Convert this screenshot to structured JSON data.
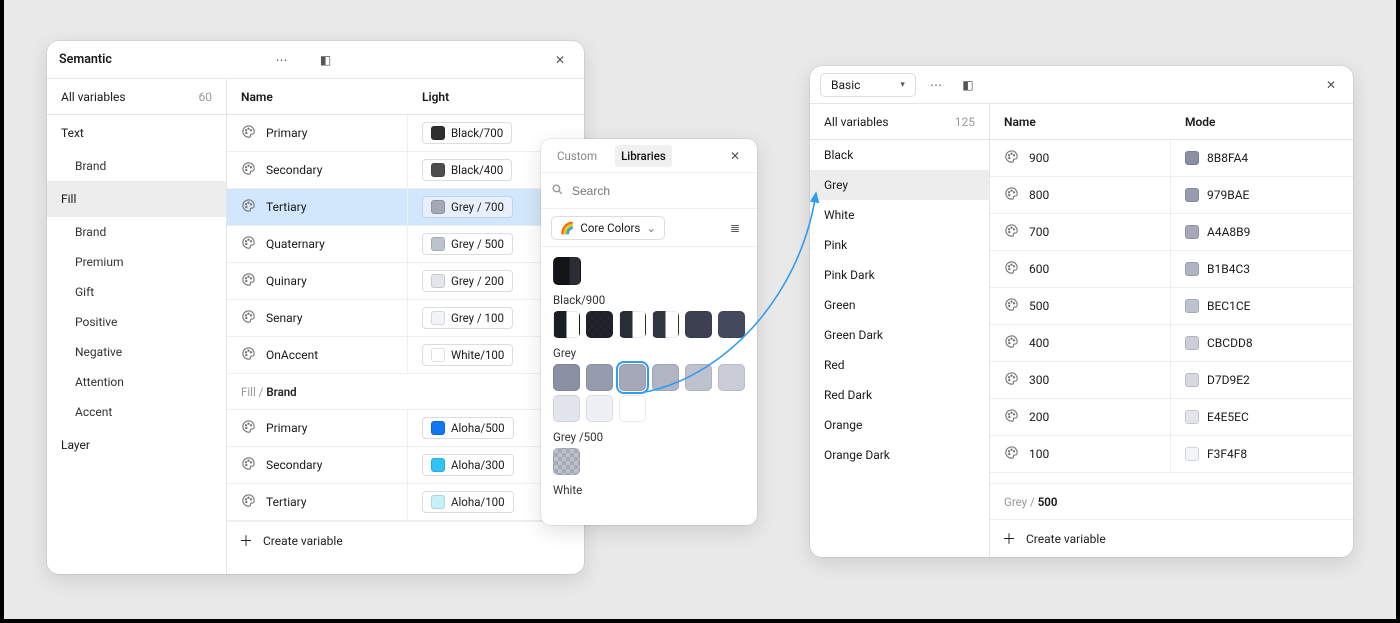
{
  "semantic_panel": {
    "title": "Semantic",
    "all_variables_label": "All variables",
    "all_variables_count": "60",
    "groups": [
      {
        "label": "Text",
        "children": [
          {
            "label": "Brand"
          }
        ]
      },
      {
        "label": "Fill",
        "active": true,
        "children": [
          {
            "label": "Brand"
          },
          {
            "label": "Premium"
          },
          {
            "label": "Gift"
          },
          {
            "label": "Positive"
          },
          {
            "label": "Negative"
          },
          {
            "label": "Attention"
          },
          {
            "label": "Accent"
          }
        ]
      },
      {
        "label": "Layer",
        "children": []
      }
    ],
    "columns": {
      "name": "Name",
      "light": "Light"
    },
    "sections": [
      {
        "title_prefix": "",
        "title_bold": "",
        "rows": [
          {
            "name": "Primary",
            "value_label": "Black/700",
            "color": "#2f2f2f"
          },
          {
            "name": "Secondary",
            "value_label": "Black/400",
            "color": "#4d4d4d"
          },
          {
            "name": "Tertiary",
            "value_label": "Grey / 700",
            "color": "#a4a8b9",
            "selected": true
          },
          {
            "name": "Quaternary",
            "value_label": "Grey / 500",
            "color": "#bec1ce"
          },
          {
            "name": "Quinary",
            "value_label": "Grey / 200",
            "color": "#e4e5ec"
          },
          {
            "name": "Senary",
            "value_label": "Grey / 100",
            "color": "#f3f4f8"
          },
          {
            "name": "OnAccent",
            "value_label": "White/100",
            "color": "#ffffff"
          }
        ]
      },
      {
        "title_prefix": "Fill /",
        "title_bold": "Brand",
        "rows": [
          {
            "name": "Primary",
            "value_label": "Aloha/500",
            "color": "#0f78f0"
          },
          {
            "name": "Secondary",
            "value_label": "Aloha/300",
            "color": "#2fc4f5"
          },
          {
            "name": "Tertiary",
            "value_label": "Aloha/100",
            "color": "#c6f1f9"
          }
        ]
      }
    ],
    "create_label": "Create variable"
  },
  "popover": {
    "tabs": {
      "custom": "Custom",
      "libraries": "Libraries",
      "active": "libraries"
    },
    "search_placeholder": "Search",
    "combo_label": "Core Colors",
    "combo_icon": "🌈",
    "groups": [
      {
        "label": "Black/900",
        "big": "#131417",
        "swatches": [
          {
            "c": "#1a1d24",
            "half": true
          },
          {
            "c": "#21242c",
            "checker": true
          },
          {
            "c": "#2a2d36",
            "half": true
          },
          {
            "c": "#333640",
            "half": true
          },
          {
            "c": "#3c4050"
          },
          {
            "c": "#454a5c"
          }
        ]
      },
      {
        "label": "Grey",
        "swatches": [
          {
            "c": "#8b8fa4"
          },
          {
            "c": "#979bae"
          },
          {
            "c": "#a4a8b9",
            "sel": true
          },
          {
            "c": "#b1b4c3"
          },
          {
            "c": "#bec1ce"
          },
          {
            "c": "#cacdd8"
          },
          {
            "c": "#e3e5ec"
          },
          {
            "c": "#eff0f5"
          },
          {
            "c": "#ffffff"
          }
        ]
      },
      {
        "label": "Grey /500",
        "swatches": [
          {
            "c": "#bec1ce",
            "checker": true
          }
        ]
      },
      {
        "label": "White"
      }
    ]
  },
  "basic_panel": {
    "dropdown_label": "Basic",
    "all_variables_label": "All variables",
    "all_variables_count": "125",
    "groups": [
      "Black",
      "Grey",
      "White",
      "Pink",
      "Pink Dark",
      "Green",
      "Green Dark",
      "Red",
      "Red Dark",
      "Orange",
      "Orange Dark"
    ],
    "groups_active": "Grey",
    "columns": {
      "name": "Name",
      "mode": "Mode"
    },
    "rows": [
      {
        "name": "900",
        "value_label": "8B8FA4",
        "color": "#8b8fa4"
      },
      {
        "name": "800",
        "value_label": "979BAE",
        "color": "#979bae"
      },
      {
        "name": "700",
        "value_label": "A4A8B9",
        "color": "#a4a8b9"
      },
      {
        "name": "600",
        "value_label": "B1B4C3",
        "color": "#b1b4c3"
      },
      {
        "name": "500",
        "value_label": "BEC1CE",
        "color": "#bec1ce"
      },
      {
        "name": "400",
        "value_label": "CBCDD8",
        "color": "#cbcdd8"
      },
      {
        "name": "300",
        "value_label": "D7D9E2",
        "color": "#d7d9e2"
      },
      {
        "name": "200",
        "value_label": "E4E5EC",
        "color": "#e4e5ec"
      },
      {
        "name": "100",
        "value_label": "F3F4F8",
        "color": "#f3f4f8"
      }
    ],
    "path_prefix": "Grey /",
    "path_bold": "500",
    "create_label": "Create variable"
  },
  "icons": {
    "dots": "⋯",
    "panel": "◧",
    "close": "✕",
    "plus": "＋",
    "list": "≣",
    "search": "🔍",
    "chevron": "⌄",
    "caret": "▾"
  }
}
